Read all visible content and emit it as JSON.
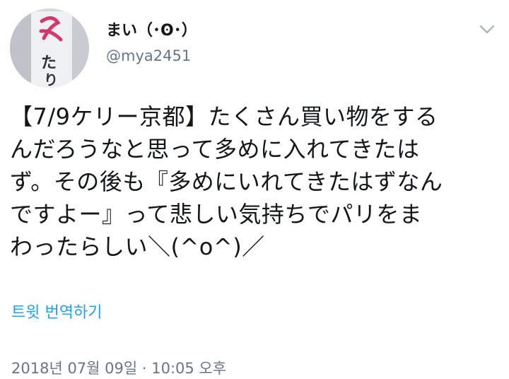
{
  "user": {
    "display_name": "まい（･ʘ･）",
    "handle": "@mya2451",
    "avatar_text": "ふ たり"
  },
  "tweet": {
    "text": "【7/9ケリー京都】たくさん買い物をする\nんだろうなと思って多めに入れてきたは\nず。その後も『多めにいれてきたはずなん\nですよー』って悲しい気持ちでパリをま\nわったらしい＼(^o^)／"
  },
  "actions": {
    "translate_label": "트윗 번역하기",
    "menu_icon": "chevron-down-icon"
  },
  "meta": {
    "timestamp": "2018년 07월 09일 · 10:05 오후"
  },
  "colors": {
    "text": "#14171a",
    "secondary": "#657786",
    "link": "#1da1f2",
    "chevron": "#aab8c2"
  }
}
